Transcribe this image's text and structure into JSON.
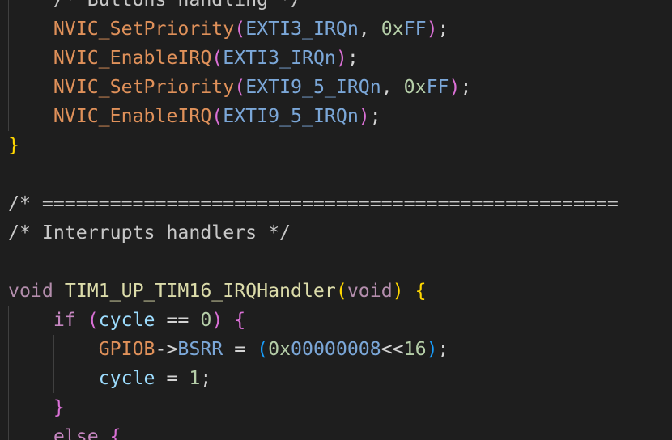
{
  "editor": {
    "lines": [
      {
        "indent": 1,
        "tokens": [
          {
            "t": "/* Buttons handling */",
            "c": "tok-comment"
          }
        ]
      },
      {
        "indent": 1,
        "tokens": [
          {
            "t": "NVIC_SetPriority",
            "c": "tok-func-orange"
          },
          {
            "t": "(",
            "c": "tok-bracket-2"
          },
          {
            "t": "EXTI3_IRQn",
            "c": "tok-const"
          },
          {
            "t": ", ",
            "c": "tok-punc"
          },
          {
            "t": "0x",
            "c": "tok-num"
          },
          {
            "t": "FF",
            "c": "tok-const"
          },
          {
            "t": ")",
            "c": "tok-bracket-2"
          },
          {
            "t": ";",
            "c": "tok-punc"
          }
        ]
      },
      {
        "indent": 1,
        "tokens": [
          {
            "t": "NVIC_EnableIRQ",
            "c": "tok-func-orange"
          },
          {
            "t": "(",
            "c": "tok-bracket-2"
          },
          {
            "t": "EXTI3_IRQn",
            "c": "tok-const"
          },
          {
            "t": ")",
            "c": "tok-bracket-2"
          },
          {
            "t": ";",
            "c": "tok-punc"
          }
        ]
      },
      {
        "indent": 1,
        "tokens": [
          {
            "t": "NVIC_SetPriority",
            "c": "tok-func-orange"
          },
          {
            "t": "(",
            "c": "tok-bracket-2"
          },
          {
            "t": "EXTI9_5_IRQn",
            "c": "tok-const"
          },
          {
            "t": ", ",
            "c": "tok-punc"
          },
          {
            "t": "0x",
            "c": "tok-num"
          },
          {
            "t": "FF",
            "c": "tok-const"
          },
          {
            "t": ")",
            "c": "tok-bracket-2"
          },
          {
            "t": ";",
            "c": "tok-punc"
          }
        ]
      },
      {
        "indent": 1,
        "tokens": [
          {
            "t": "NVIC_EnableIRQ",
            "c": "tok-func-orange"
          },
          {
            "t": "(",
            "c": "tok-bracket-2"
          },
          {
            "t": "EXTI9_5_IRQn",
            "c": "tok-const"
          },
          {
            "t": ")",
            "c": "tok-bracket-2"
          },
          {
            "t": ";",
            "c": "tok-punc"
          }
        ]
      },
      {
        "indent": 0,
        "tokens": [
          {
            "t": "}",
            "c": "tok-bracket-1"
          }
        ]
      },
      {
        "indent": 0,
        "tokens": []
      },
      {
        "indent": 0,
        "tokens": [
          {
            "t": "/* ===================================================",
            "c": "tok-comment"
          }
        ]
      },
      {
        "indent": 0,
        "tokens": [
          {
            "t": "/* Interrupts handlers */",
            "c": "tok-comment"
          }
        ]
      },
      {
        "indent": 0,
        "tokens": []
      },
      {
        "indent": 0,
        "tokens": [
          {
            "t": "void",
            "c": "tok-type"
          },
          {
            "t": " ",
            "c": "tok-punc"
          },
          {
            "t": "TIM1_UP_TIM16_IRQHandler",
            "c": "tok-func"
          },
          {
            "t": "(",
            "c": "tok-bracket-1"
          },
          {
            "t": "void",
            "c": "tok-type"
          },
          {
            "t": ")",
            "c": "tok-bracket-1"
          },
          {
            "t": " ",
            "c": "tok-punc"
          },
          {
            "t": "{",
            "c": "tok-bracket-1"
          }
        ]
      },
      {
        "indent": 1,
        "tokens": [
          {
            "t": "if",
            "c": "tok-kw"
          },
          {
            "t": " ",
            "c": "tok-punc"
          },
          {
            "t": "(",
            "c": "tok-bracket-2"
          },
          {
            "t": "cycle",
            "c": "tok-var"
          },
          {
            "t": " == ",
            "c": "tok-op"
          },
          {
            "t": "0",
            "c": "tok-num"
          },
          {
            "t": ")",
            "c": "tok-bracket-2"
          },
          {
            "t": " ",
            "c": "tok-punc"
          },
          {
            "t": "{",
            "c": "tok-bracket-2"
          }
        ]
      },
      {
        "indent": 2,
        "tokens": [
          {
            "t": "GPIOB",
            "c": "tok-func-orange"
          },
          {
            "t": "->",
            "c": "tok-op"
          },
          {
            "t": "BSRR",
            "c": "tok-const"
          },
          {
            "t": " = ",
            "c": "tok-op"
          },
          {
            "t": "(",
            "c": "tok-bracket-3"
          },
          {
            "t": "0x",
            "c": "tok-num"
          },
          {
            "t": "00000008",
            "c": "tok-const"
          },
          {
            "t": "<<",
            "c": "tok-op"
          },
          {
            "t": "16",
            "c": "tok-num"
          },
          {
            "t": ")",
            "c": "tok-bracket-3"
          },
          {
            "t": ";",
            "c": "tok-punc"
          }
        ]
      },
      {
        "indent": 2,
        "tokens": [
          {
            "t": "cycle",
            "c": "tok-var"
          },
          {
            "t": " = ",
            "c": "tok-op"
          },
          {
            "t": "1",
            "c": "tok-num"
          },
          {
            "t": ";",
            "c": "tok-punc"
          }
        ]
      },
      {
        "indent": 1,
        "tokens": [
          {
            "t": "}",
            "c": "tok-bracket-2"
          }
        ]
      },
      {
        "indent": 1,
        "tokens": [
          {
            "t": "else",
            "c": "tok-kw"
          },
          {
            "t": " ",
            "c": "tok-punc"
          },
          {
            "t": "{",
            "c": "tok-bracket-2"
          }
        ]
      }
    ]
  }
}
